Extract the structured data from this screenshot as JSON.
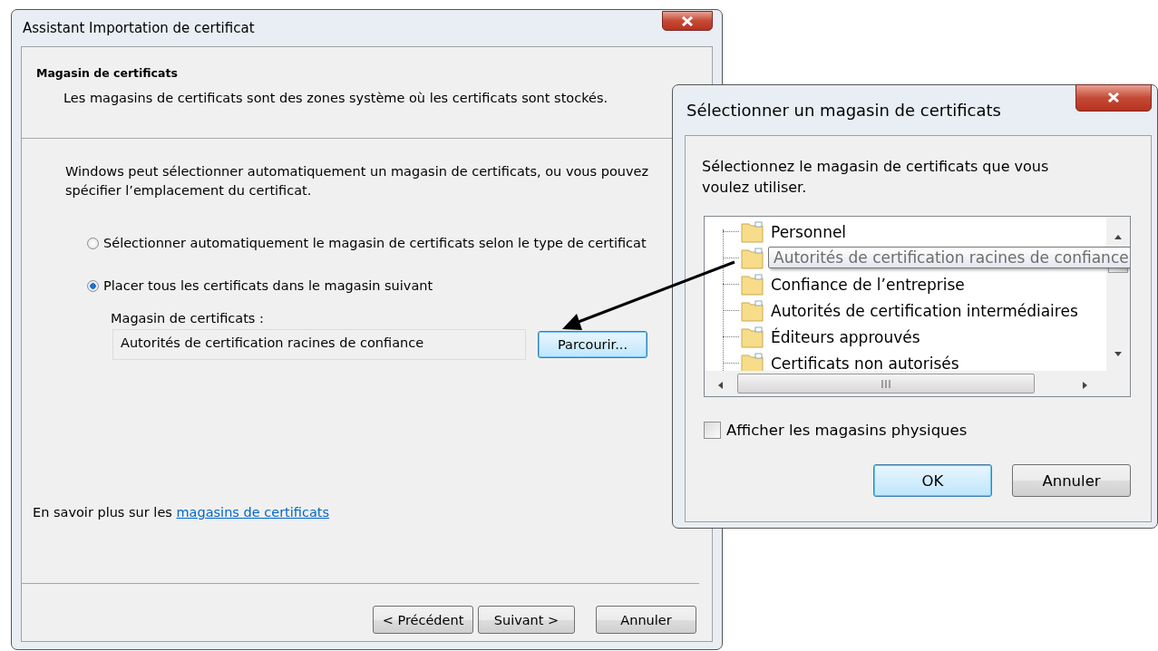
{
  "wizard": {
    "title": "Assistant Importation de certificat",
    "heading": "Magasin de certificats",
    "subheading": "Les magasins de certificats sont des zones système où les certificats sont stockés.",
    "intro": "Windows peut sélectionner automatiquement un magasin de certificats, ou vous pouvez spécifier l’emplacement du certificat.",
    "options": [
      {
        "label": "Sélectionner automatiquement le magasin de certificats selon le type de certificat",
        "selected": false
      },
      {
        "label": "Placer tous les certificats dans le magasin suivant",
        "selected": true
      }
    ],
    "store_label": "Magasin de certificats :",
    "store_value": "Autorités de certification racines de confiance",
    "browse_button": "Parcourir...",
    "learn_more": {
      "text": "En savoir plus sur les",
      "link": "magasins de certificats"
    },
    "buttons": [
      "< Précédent",
      "Suivant >",
      "Annuler"
    ]
  },
  "dialog": {
    "title": "Sélectionner un magasin de certificats",
    "prompt": "Sélectionnez le magasin de certificats que vous voulez utiliser.",
    "stores": [
      {
        "label": "Personnel",
        "tooltip": false
      },
      {
        "label": "Autorités de certification racines de confiance",
        "tooltip": true
      },
      {
        "label": "Confiance de l’entreprise",
        "tooltip": false
      },
      {
        "label": "Autorités de certification intermédiaires",
        "tooltip": false
      },
      {
        "label": "Éditeurs approuvés",
        "tooltip": false
      },
      {
        "label": "Certificats non autorisés",
        "tooltip": false
      }
    ],
    "show_physical": {
      "label": "Afficher les magasins physiques",
      "checked": false
    },
    "buttons": [
      "OK",
      "Annuler"
    ]
  }
}
